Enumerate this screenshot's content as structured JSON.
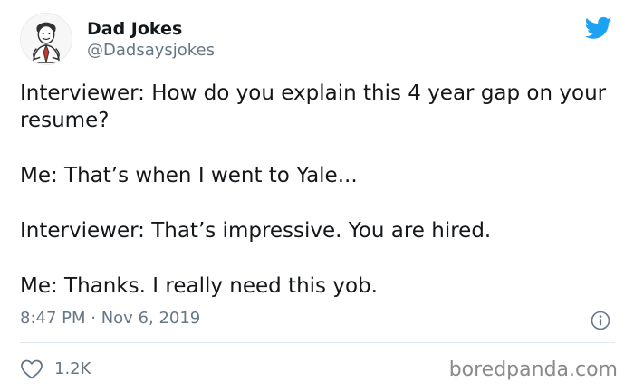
{
  "author": {
    "display_name": "Dad Jokes",
    "handle": "@Dadsaysjokes"
  },
  "tweet": {
    "lines": [
      "Interviewer: How do you explain this 4 year gap on your resume?",
      "Me: That’s when I went to Yale...",
      "Interviewer: That’s impressive. You are hired.",
      "Me: Thanks. I really need this yob."
    ],
    "timestamp": "8:47 PM · Nov 6, 2019"
  },
  "engagement": {
    "likes": "1.2K"
  },
  "watermark": "boredpanda.com",
  "colors": {
    "twitter_blue": "#1da1f2",
    "secondary_text": "#657786",
    "primary_text": "#14171a"
  },
  "icons": {
    "brand": "twitter-bird-icon",
    "info": "info-icon",
    "like": "heart-icon"
  }
}
